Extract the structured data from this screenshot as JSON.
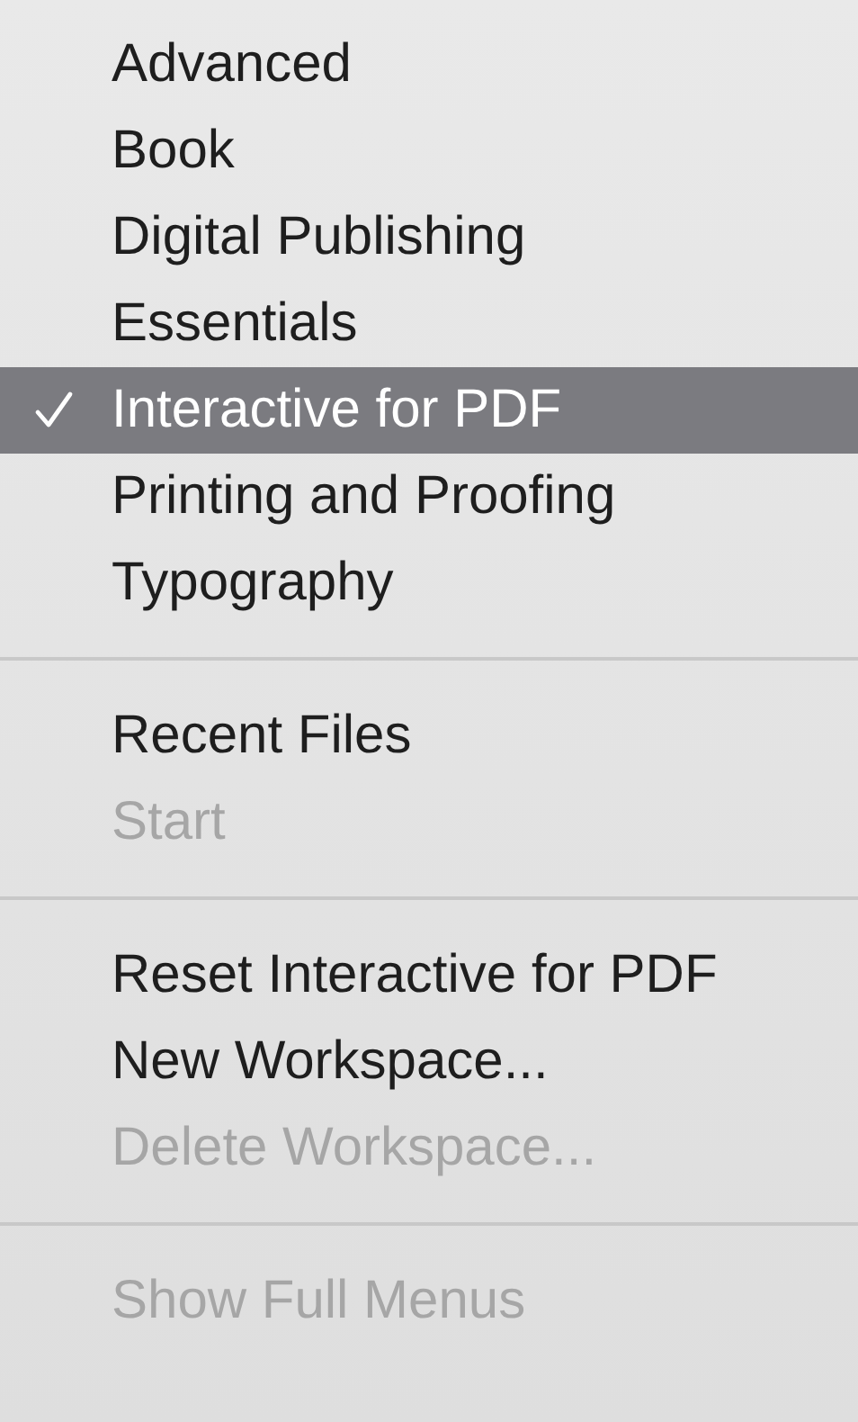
{
  "menu": {
    "sections": [
      {
        "items": [
          {
            "label": "Advanced",
            "checked": false,
            "selected": false,
            "disabled": false
          },
          {
            "label": "Book",
            "checked": false,
            "selected": false,
            "disabled": false
          },
          {
            "label": "Digital Publishing",
            "checked": false,
            "selected": false,
            "disabled": false
          },
          {
            "label": "Essentials",
            "checked": false,
            "selected": false,
            "disabled": false
          },
          {
            "label": "Interactive for PDF",
            "checked": true,
            "selected": true,
            "disabled": false
          },
          {
            "label": "Printing and Proofing",
            "checked": false,
            "selected": false,
            "disabled": false
          },
          {
            "label": "Typography",
            "checked": false,
            "selected": false,
            "disabled": false
          }
        ]
      },
      {
        "items": [
          {
            "label": "Recent Files",
            "checked": false,
            "selected": false,
            "disabled": false
          },
          {
            "label": "Start",
            "checked": false,
            "selected": false,
            "disabled": true
          }
        ]
      },
      {
        "items": [
          {
            "label": "Reset Interactive for PDF",
            "checked": false,
            "selected": false,
            "disabled": false
          },
          {
            "label": "New Workspace...",
            "checked": false,
            "selected": false,
            "disabled": false
          },
          {
            "label": "Delete Workspace...",
            "checked": false,
            "selected": false,
            "disabled": true
          }
        ]
      },
      {
        "items": [
          {
            "label": "Show Full Menus",
            "checked": false,
            "selected": false,
            "disabled": true
          }
        ]
      }
    ]
  }
}
